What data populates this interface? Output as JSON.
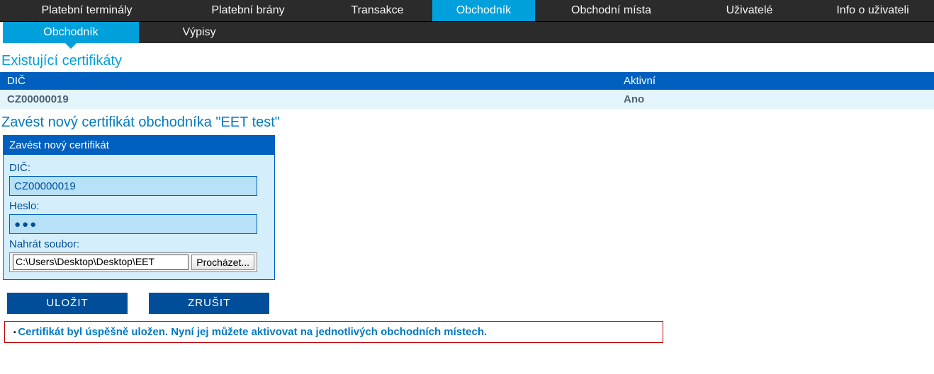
{
  "nav": {
    "primary": [
      "Platební terminály",
      "Platební brány",
      "Transakce",
      "Obchodník",
      "Obchodní místa",
      "Uživatelé",
      "Info o uživateli"
    ],
    "sub": [
      "Obchodník",
      "Výpisy"
    ]
  },
  "headings": {
    "existing": "Existující certifikáty",
    "new_cert": "Zavést nový certifikát obchodníka \"EET test\""
  },
  "cert_table": {
    "head_dic": "DIČ",
    "head_active": "Aktivní",
    "row": {
      "dic": "CZ00000019",
      "active": "Ano"
    }
  },
  "panel": {
    "title": "Zavést nový certifikát",
    "dic_label": "DIČ:",
    "dic_value": "CZ00000019",
    "pwd_label": "Heslo:",
    "pwd_value": "●●●",
    "upload_label": "Nahrát soubor:",
    "file_path": "C:\\Users\\Desktop\\Desktop\\EET",
    "browse_btn": "Procházet..."
  },
  "actions": {
    "save": "ULOŽIT",
    "cancel": "ZRUŠIT"
  },
  "message": "Certifikát byl úspěšně uložen. Nyní jej můžete aktivovat na jednotlivých obchodních místech."
}
